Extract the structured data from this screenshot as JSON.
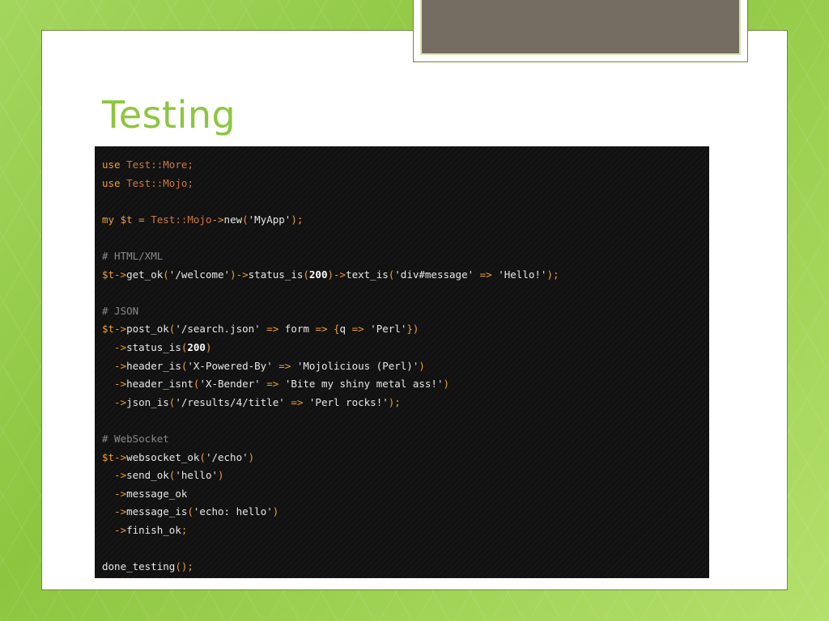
{
  "slide": {
    "title": "Testing"
  },
  "code_lines": [
    [
      {
        "t": "use ",
        "c": "k"
      },
      {
        "t": "Test::More;",
        "c": "p"
      }
    ],
    [
      {
        "t": "use ",
        "c": "k"
      },
      {
        "t": "Test::Mojo;",
        "c": "p"
      }
    ],
    [],
    [
      {
        "t": "my $t = ",
        "c": "k"
      },
      {
        "t": "Test::Mojo",
        "c": "p"
      },
      {
        "t": "->",
        "c": "k"
      },
      {
        "t": "new",
        "c": "t"
      },
      {
        "t": "(",
        "c": "k"
      },
      {
        "t": "'MyApp'",
        "c": "s"
      },
      {
        "t": ");",
        "c": "k"
      }
    ],
    [],
    [
      {
        "t": "# HTML/XML",
        "c": "c"
      }
    ],
    [
      {
        "t": "$t->",
        "c": "k"
      },
      {
        "t": "get_ok",
        "c": "t"
      },
      {
        "t": "(",
        "c": "k"
      },
      {
        "t": "'/welcome'",
        "c": "s"
      },
      {
        "t": ")->",
        "c": "k"
      },
      {
        "t": "status_is",
        "c": "t"
      },
      {
        "t": "(",
        "c": "k"
      },
      {
        "t": "200",
        "c": "n"
      },
      {
        "t": ")->",
        "c": "k"
      },
      {
        "t": "text_is",
        "c": "t"
      },
      {
        "t": "(",
        "c": "k"
      },
      {
        "t": "'div#message'",
        "c": "s"
      },
      {
        "t": " => ",
        "c": "k"
      },
      {
        "t": "'Hello!'",
        "c": "s"
      },
      {
        "t": ");",
        "c": "k"
      }
    ],
    [],
    [
      {
        "t": "# JSON",
        "c": "c"
      }
    ],
    [
      {
        "t": "$t->",
        "c": "k"
      },
      {
        "t": "post_ok",
        "c": "t"
      },
      {
        "t": "(",
        "c": "k"
      },
      {
        "t": "'/search.json'",
        "c": "s"
      },
      {
        "t": " => ",
        "c": "k"
      },
      {
        "t": "form",
        "c": "t"
      },
      {
        "t": " => {",
        "c": "k"
      },
      {
        "t": "q",
        "c": "t"
      },
      {
        "t": " => ",
        "c": "k"
      },
      {
        "t": "'Perl'",
        "c": "s"
      },
      {
        "t": "})",
        "c": "k"
      }
    ],
    [
      {
        "t": "  ->",
        "c": "k"
      },
      {
        "t": "status_is",
        "c": "t"
      },
      {
        "t": "(",
        "c": "k"
      },
      {
        "t": "200",
        "c": "n"
      },
      {
        "t": ")",
        "c": "k"
      }
    ],
    [
      {
        "t": "  ->",
        "c": "k"
      },
      {
        "t": "header_is",
        "c": "t"
      },
      {
        "t": "(",
        "c": "k"
      },
      {
        "t": "'X-Powered-By'",
        "c": "s"
      },
      {
        "t": " => ",
        "c": "k"
      },
      {
        "t": "'Mojolicious (Perl)'",
        "c": "s"
      },
      {
        "t": ")",
        "c": "k"
      }
    ],
    [
      {
        "t": "  ->",
        "c": "k"
      },
      {
        "t": "header_isnt",
        "c": "t"
      },
      {
        "t": "(",
        "c": "k"
      },
      {
        "t": "'X-Bender'",
        "c": "s"
      },
      {
        "t": " => ",
        "c": "k"
      },
      {
        "t": "'Bite my shiny metal ass!'",
        "c": "s"
      },
      {
        "t": ")",
        "c": "k"
      }
    ],
    [
      {
        "t": "  ->",
        "c": "k"
      },
      {
        "t": "json_is",
        "c": "t"
      },
      {
        "t": "(",
        "c": "k"
      },
      {
        "t": "'/results/4/title'",
        "c": "s"
      },
      {
        "t": " => ",
        "c": "k"
      },
      {
        "t": "'Perl rocks!'",
        "c": "s"
      },
      {
        "t": ");",
        "c": "k"
      }
    ],
    [],
    [
      {
        "t": "# WebSocket",
        "c": "c"
      }
    ],
    [
      {
        "t": "$t->",
        "c": "k"
      },
      {
        "t": "websocket_ok",
        "c": "t"
      },
      {
        "t": "(",
        "c": "k"
      },
      {
        "t": "'/echo'",
        "c": "s"
      },
      {
        "t": ")",
        "c": "k"
      }
    ],
    [
      {
        "t": "  ->",
        "c": "k"
      },
      {
        "t": "send_ok",
        "c": "t"
      },
      {
        "t": "(",
        "c": "k"
      },
      {
        "t": "'hello'",
        "c": "s"
      },
      {
        "t": ")",
        "c": "k"
      }
    ],
    [
      {
        "t": "  ->",
        "c": "k"
      },
      {
        "t": "message_ok",
        "c": "t"
      }
    ],
    [
      {
        "t": "  ->",
        "c": "k"
      },
      {
        "t": "message_is",
        "c": "t"
      },
      {
        "t": "(",
        "c": "k"
      },
      {
        "t": "'echo: hello'",
        "c": "s"
      },
      {
        "t": ")",
        "c": "k"
      }
    ],
    [
      {
        "t": "  ->",
        "c": "k"
      },
      {
        "t": "finish_ok",
        "c": "t"
      },
      {
        "t": ";",
        "c": "k"
      }
    ],
    [],
    [
      {
        "t": "done_testing",
        "c": "t"
      },
      {
        "t": "();",
        "c": "k"
      }
    ]
  ]
}
